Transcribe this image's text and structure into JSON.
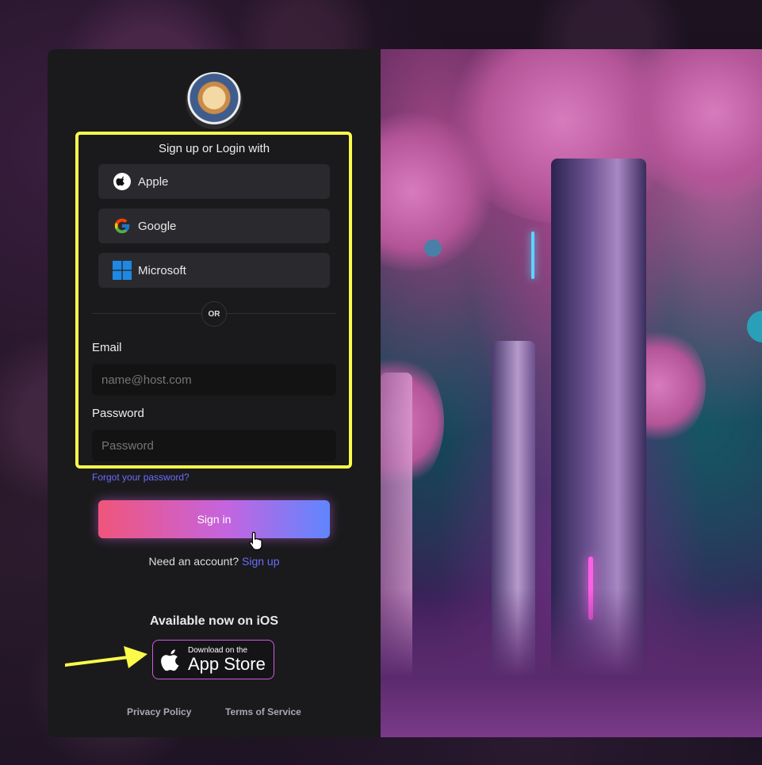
{
  "login": {
    "heading": "Sign up or Login with",
    "providers": [
      {
        "label": "Apple",
        "icon": "apple-icon"
      },
      {
        "label": "Google",
        "icon": "google-icon"
      },
      {
        "label": "Microsoft",
        "icon": "microsoft-icon"
      }
    ],
    "divider_text": "OR",
    "email": {
      "label": "Email",
      "placeholder": "name@host.com",
      "value": ""
    },
    "password": {
      "label": "Password",
      "placeholder": "Password",
      "value": ""
    },
    "forgot_link": "Forgot your password?",
    "sign_in_button": "Sign in",
    "need_account": "Need an account?",
    "sign_up_link": "Sign up"
  },
  "ios": {
    "heading": "Available now on iOS",
    "badge_small": "Download on the",
    "badge_large": "App Store"
  },
  "footer": {
    "privacy": "Privacy Policy",
    "terms": "Terms of Service"
  },
  "colors": {
    "highlight_frame": "#fbfa4b",
    "link": "#6b6bff",
    "gradient_start": "#f0557b",
    "gradient_end": "#5f86ff"
  }
}
